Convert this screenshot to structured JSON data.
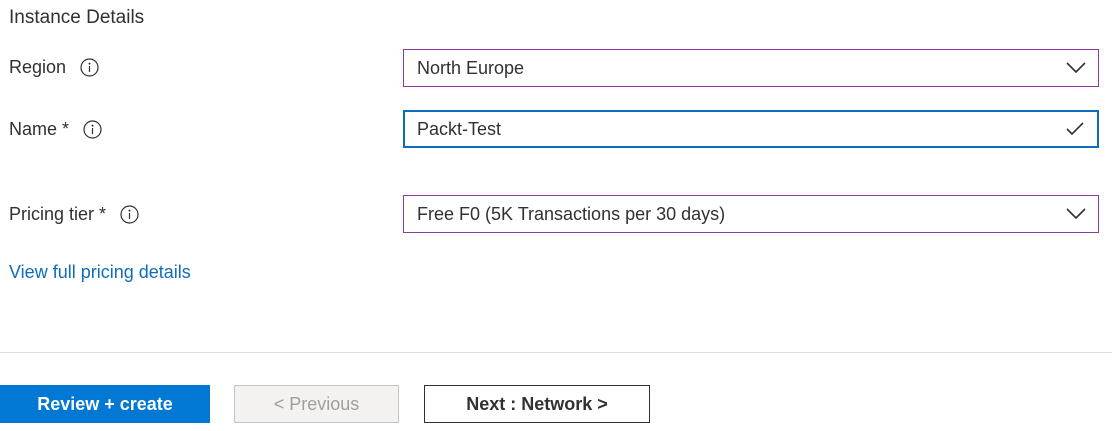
{
  "section": {
    "title": "Instance Details"
  },
  "region": {
    "label": "Region",
    "value": "North Europe",
    "info_icon": "info-icon",
    "trail_icon": "chevron-down-icon"
  },
  "name": {
    "label": "Name *",
    "value": "Packt-Test",
    "info_icon": "info-icon",
    "trail_icon": "checkmark-icon"
  },
  "pricing": {
    "label": "Pricing tier *",
    "value": "Free F0 (5K Transactions per 30 days)",
    "info_icon": "info-icon",
    "trail_icon": "chevron-down-icon",
    "link": "View full pricing details"
  },
  "footer": {
    "review_create": "Review + create",
    "previous": "< Previous",
    "next": "Next : Network >"
  },
  "colors": {
    "primary": "#0078d4",
    "link": "#0f6cbd",
    "field_border": "#8a3c9e",
    "focus_border": "#0f6cbd"
  }
}
